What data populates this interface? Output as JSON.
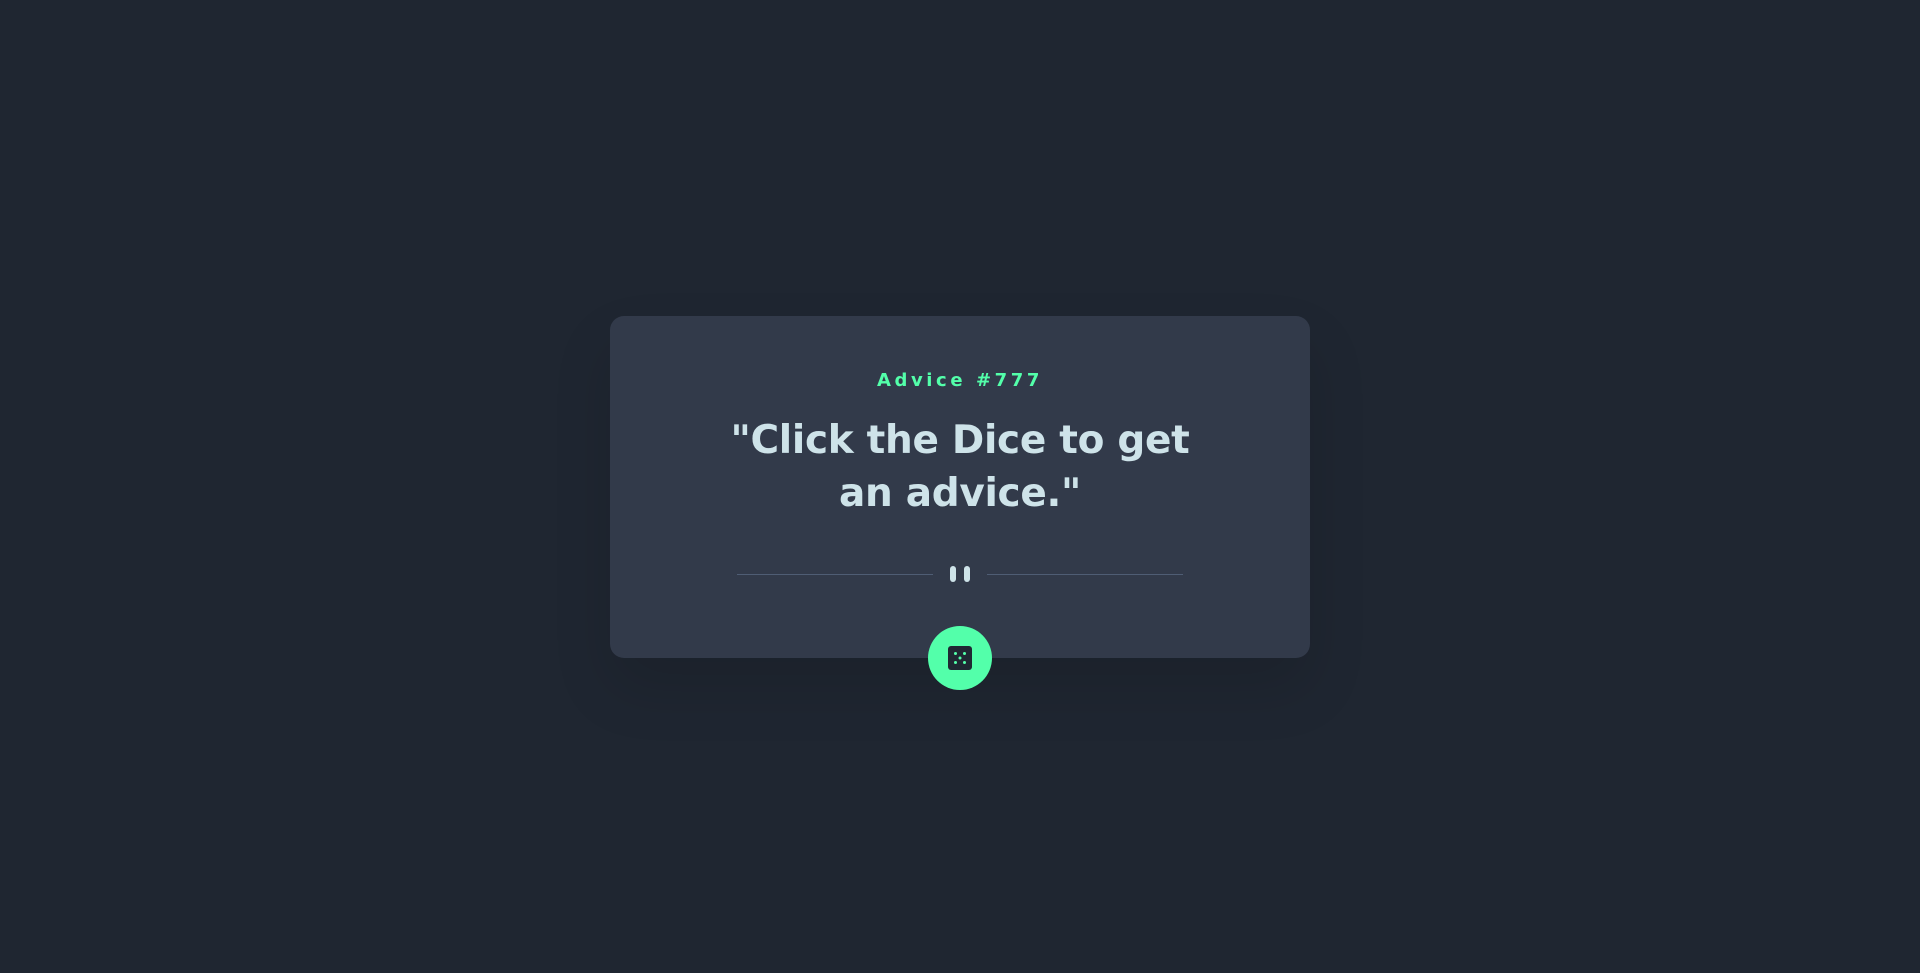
{
  "advice": {
    "id_label": "Advice #777",
    "text": "\"Click the Dice to get an advice.\""
  },
  "icons": {
    "divider": "pause-icon",
    "button": "dice-icon"
  },
  "colors": {
    "background": "#1f2631",
    "card": "#323a4a",
    "accent": "#53ffaa",
    "text": "#cee3e9",
    "divider_line": "#4f5d74"
  }
}
